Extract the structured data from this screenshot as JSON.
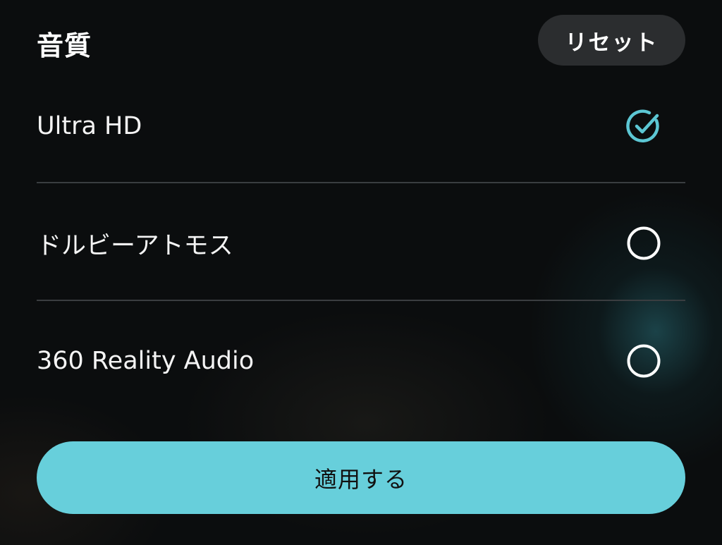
{
  "header": {
    "title": "音質",
    "reset_label": "リセット"
  },
  "options": [
    {
      "label": "Ultra HD",
      "selected": true
    },
    {
      "label": "ドルビーアトモス",
      "selected": false
    },
    {
      "label": "360 Reality Audio",
      "selected": false
    }
  ],
  "footer": {
    "apply_label": "適用する"
  },
  "colors": {
    "accent": "#67cfdb",
    "background": "#0b0d0e",
    "reset_button": "#2b2d2f",
    "divider": "#3a3d40",
    "check_icon": "#5cc7d4"
  },
  "icons": {
    "selected": "check-circle-icon",
    "unselected": "radio-circle-icon"
  }
}
